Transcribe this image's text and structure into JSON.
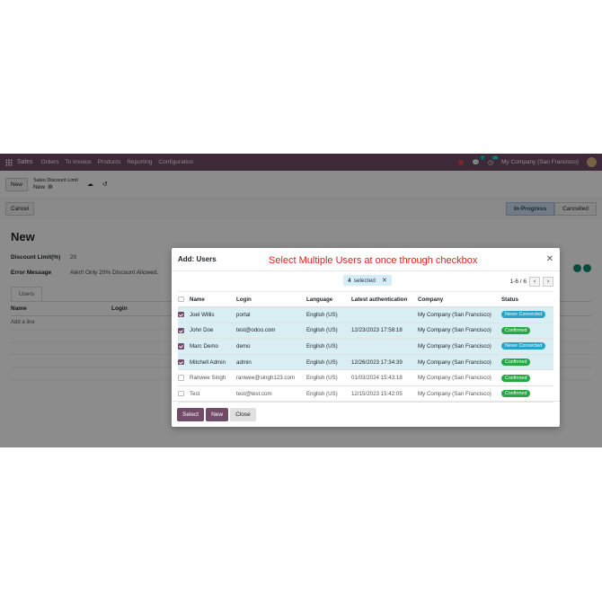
{
  "navbar": {
    "app_name": "Sales",
    "menu": [
      "Orders",
      "To Invoice",
      "Products",
      "Reporting",
      "Configuration"
    ],
    "chat_badge": "7",
    "activity_badge": "29",
    "company": "My Company (San Francisco)"
  },
  "control": {
    "new_label": "New",
    "breadcrumb_parent": "Sales Discount Limit",
    "breadcrumb_current": "New"
  },
  "statusbar": {
    "cancel_label": "Cancel",
    "stages": [
      "In-Progress",
      "Cancelled"
    ]
  },
  "form": {
    "title": "New",
    "discount_label": "Discount Limit(%)",
    "discount_value": "20",
    "error_label": "Error Message",
    "error_value": "Alert! Only 20% Discount Allowed.",
    "tab_users": "Users",
    "col_name": "Name",
    "col_login": "Login",
    "add_line": "Add a line"
  },
  "modal": {
    "title": "Add: Users",
    "annotation": "Select Multiple Users at once through checkbox",
    "selected_count": "4",
    "selected_text": "selected",
    "pager": "1-6 / 6",
    "columns": [
      "Name",
      "Login",
      "Language",
      "Latest authentication",
      "Company",
      "Status"
    ],
    "rows": [
      {
        "name": "Joel Willis",
        "login": "portal",
        "language": "English (US)",
        "auth": "",
        "company": "My Company (San Francisco)",
        "status": "Never Connected",
        "selected": true
      },
      {
        "name": "John Doe",
        "login": "test@odoo.com",
        "language": "English (US)",
        "auth": "12/23/2023 17:58:18",
        "company": "My Company (San Francisco)",
        "status": "Confirmed",
        "selected": true
      },
      {
        "name": "Marc Demo",
        "login": "demo",
        "language": "English (US)",
        "auth": "",
        "company": "My Company (San Francisco)",
        "status": "Never Connected",
        "selected": true
      },
      {
        "name": "Mitchell Admin",
        "login": "admin",
        "language": "English (US)",
        "auth": "12/26/2023 17:34:39",
        "company": "My Company (San Francisco)",
        "status": "Confirmed",
        "selected": true
      },
      {
        "name": "Ranwee Singh",
        "login": "ranwee@singh123.com",
        "language": "English (US)",
        "auth": "01/03/2024 15:43:18",
        "company": "My Company (San Francisco)",
        "status": "Confirmed",
        "selected": false
      },
      {
        "name": "Test",
        "login": "test@test.com",
        "language": "English (US)",
        "auth": "12/15/2023 15:42:05",
        "company": "My Company (San Francisco)",
        "status": "Confirmed",
        "selected": false
      }
    ],
    "buttons": {
      "select": "Select",
      "new": "New",
      "close": "Close"
    }
  },
  "colors": {
    "brand": "#714b67",
    "selected_row": "#d9eef3",
    "never_connected": "#2aa3c8",
    "confirmed": "#28a745",
    "annotation": "#e02020"
  }
}
